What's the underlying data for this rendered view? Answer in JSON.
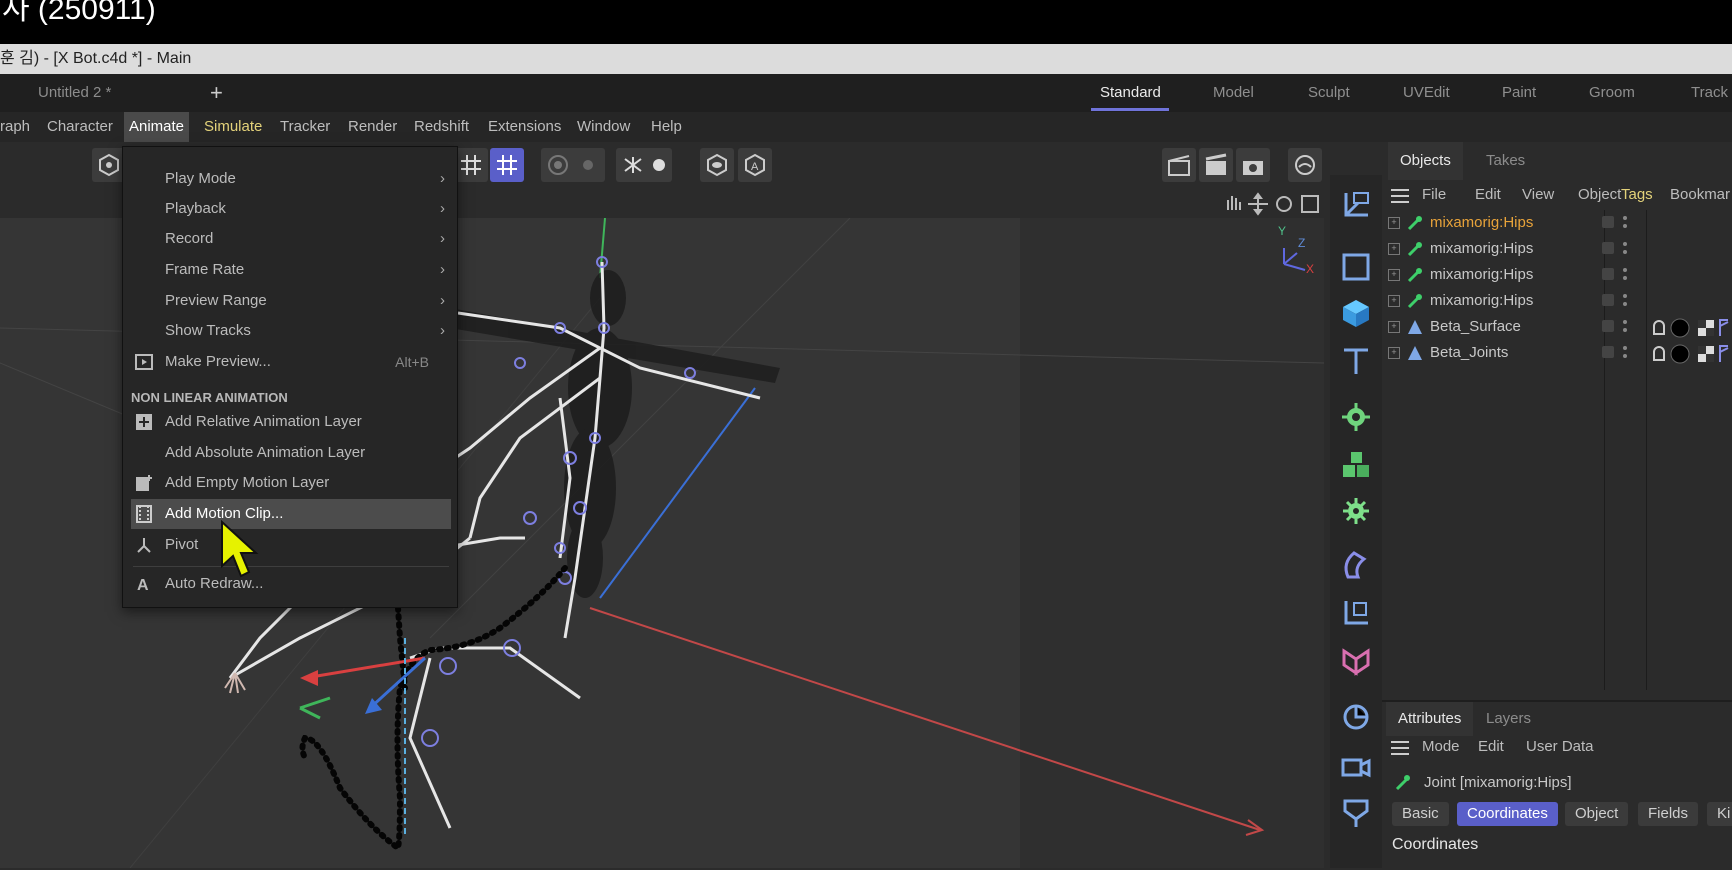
{
  "video_title": "사 (250911)",
  "window_title": "훈 김) - [X Bot.c4d *] - Main",
  "doc_tab": "Untitled 2 *",
  "add_tab": "+",
  "layouts": [
    "Standard",
    "Model",
    "Sculpt",
    "UVEdit",
    "Paint",
    "Groom",
    "Track"
  ],
  "menubar": [
    "raph",
    "Character",
    "Animate",
    "Simulate",
    "Tracker",
    "Render",
    "Redshift",
    "Extensions",
    "Window",
    "Help"
  ],
  "animate_menu": {
    "items_top": [
      {
        "label": "Play Mode",
        "arrow": "›"
      },
      {
        "label": "Playback",
        "arrow": "›"
      },
      {
        "label": "Record",
        "arrow": "›"
      },
      {
        "label": "Frame Rate",
        "arrow": "›"
      },
      {
        "label": "Preview Range",
        "arrow": "›"
      },
      {
        "label": "Show Tracks",
        "arrow": "›"
      }
    ],
    "make_preview": {
      "label": "Make Preview...",
      "shortcut": "Alt+B"
    },
    "section_label": "NON LINEAR ANIMATION",
    "nla_items": [
      "Add Relative Animation Layer",
      "Add Absolute Animation Layer",
      "Add Empty Motion Layer",
      "Add Motion Clip...",
      "Pivot"
    ],
    "auto_redraw": "Auto Redraw..."
  },
  "objects_panel": {
    "tabs": [
      "Objects",
      "Takes"
    ],
    "menu": [
      "File",
      "Edit",
      "View",
      "Object",
      "Tags",
      "Bookmar"
    ],
    "rows": [
      "mixamorig:Hips",
      "mixamorig:Hips",
      "mixamorig:Hips",
      "mixamorig:Hips",
      "Beta_Surface",
      "Beta_Joints"
    ]
  },
  "attributes_panel": {
    "tabs": [
      "Attributes",
      "Layers"
    ],
    "menu": [
      "Mode",
      "Edit",
      "User Data"
    ],
    "object_label": "Joint [mixamorig:Hips]",
    "buttons": [
      "Basic",
      "Coordinates",
      "Object",
      "Fields",
      "Ki"
    ],
    "section_title": "Coordinates"
  },
  "axis_gizmo": {
    "y": "Y",
    "z": "Z",
    "x": "X"
  },
  "colors": {
    "accent": "#5a5fc9",
    "selected_object": "#e8a33a",
    "simulate_menu": "#e3d27a",
    "joint_icon": "#3ecf6a"
  }
}
